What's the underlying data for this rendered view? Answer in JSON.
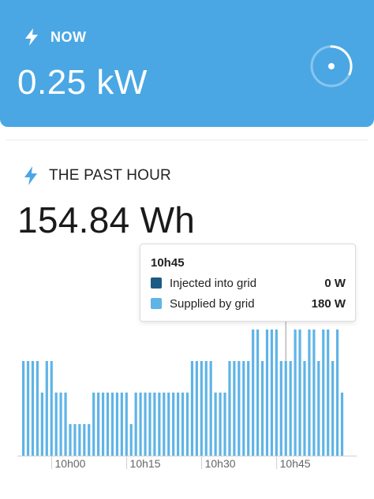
{
  "now": {
    "label": "NOW",
    "value": "0.25 kW",
    "icon": "lightning-bolt-icon",
    "gauge_icon": "gauge-ring-icon",
    "bg_color": "#4aa7e4"
  },
  "past_hour": {
    "label": "THE PAST HOUR",
    "value": "154.84 Wh",
    "icon": "lightning-bolt-icon",
    "accent_color": "#4aa7e4"
  },
  "tooltip": {
    "time": "10h45",
    "rows": [
      {
        "label": "Injected into grid",
        "value": "0 W",
        "color": "#1c5a86"
      },
      {
        "label": "Supplied by grid",
        "value": "180 W",
        "color": "#5fb4e6"
      }
    ]
  },
  "chart_data": {
    "type": "bar",
    "x_tick_labels": [
      "10h00",
      "10h15",
      "10h30",
      "10h45"
    ],
    "x_tick_indices": [
      8,
      24,
      40,
      56
    ],
    "hover_index": 56,
    "values": [
      120,
      120,
      120,
      120,
      80,
      120,
      120,
      80,
      80,
      80,
      40,
      40,
      40,
      40,
      40,
      80,
      80,
      80,
      80,
      80,
      80,
      80,
      80,
      40,
      80,
      80,
      80,
      80,
      80,
      80,
      80,
      80,
      80,
      80,
      80,
      80,
      120,
      120,
      120,
      120,
      120,
      80,
      80,
      80,
      120,
      120,
      120,
      120,
      120,
      160,
      160,
      120,
      160,
      160,
      160,
      120,
      120,
      120,
      160,
      160,
      120,
      160,
      160,
      120,
      160,
      160,
      120,
      160,
      80
    ],
    "series_color": "#5fb4e6",
    "ylim": [
      0,
      200
    ]
  }
}
